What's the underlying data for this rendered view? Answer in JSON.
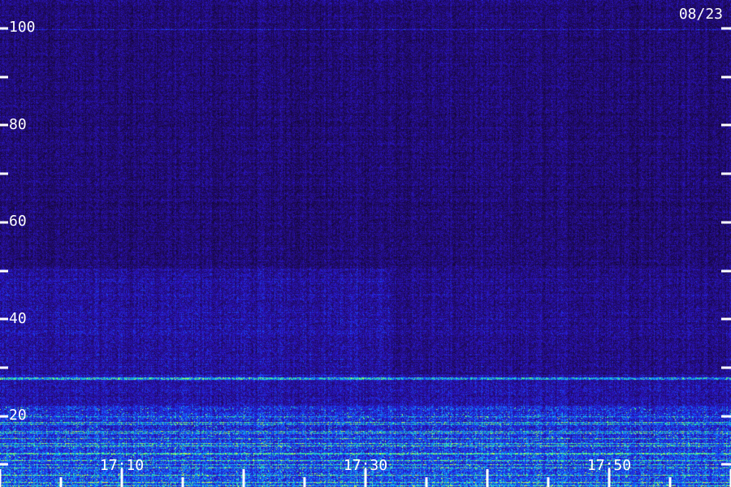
{
  "chart_data": {
    "type": "heatmap",
    "date_label": "08/23",
    "y_axis": {
      "ylim": [
        0,
        100
      ],
      "major_ticks": [
        20,
        40,
        60,
        80,
        100
      ],
      "minor_ticks": [
        10,
        30,
        50,
        70,
        90
      ],
      "labels": [
        "20",
        "40",
        "60",
        "80",
        "100"
      ]
    },
    "x_axis": {
      "labels": [
        "17:10",
        "17:30",
        "17:50"
      ]
    },
    "colors": {
      "background": "#12062a",
      "low": "#2a10a0",
      "mid": "#1a5cff",
      "high": "#40ff80",
      "peak": "#d0ff40",
      "axis": "#ffffff"
    }
  }
}
